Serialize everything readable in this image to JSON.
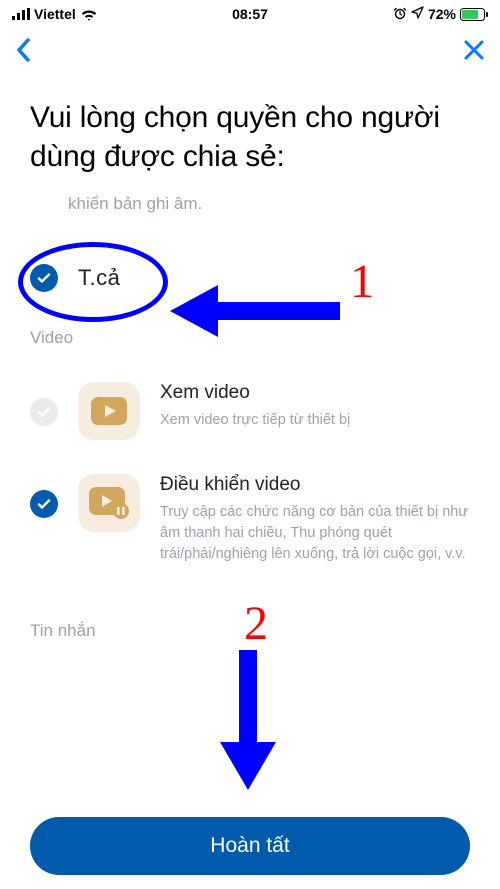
{
  "status": {
    "carrier": "Viettel",
    "time": "08:57",
    "battery_pct": "72%"
  },
  "page": {
    "title": "Vui lòng chọn quyền cho người dùng được chia sẻ:",
    "subtext": "khiển bản ghi âm.",
    "select_all_label": "T.cả",
    "section_video": "Video",
    "section_messages": "Tin nhắn",
    "done": "Hoàn tất"
  },
  "perms": {
    "view_video": {
      "title": "Xem video",
      "desc": "Xem video trực tiếp từ thiết bị"
    },
    "control_video": {
      "title": "Điều khiển video",
      "desc": "Truy cập các chức năng cơ bản của thiết bị như âm thanh hai chiều, Thu phóng quét trái/phải/nghiêng lên xuống, trả lời cuộc gọi, v.v."
    }
  },
  "annotations": {
    "one": "1",
    "two": "2"
  }
}
